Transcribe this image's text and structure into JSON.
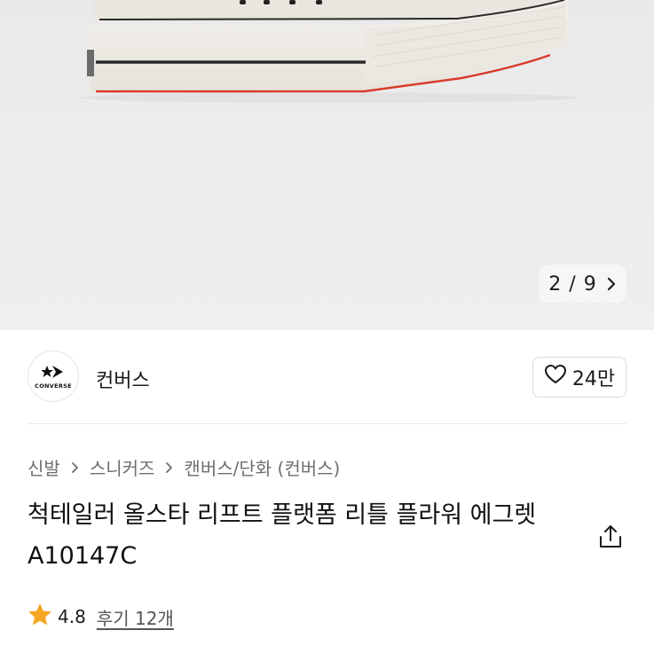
{
  "gallery": {
    "pager_text": "2 / 9"
  },
  "brand": {
    "logo_text": "CONVERSE",
    "name": "컨버스",
    "like_count": "24만"
  },
  "breadcrumb": {
    "items": [
      "신발",
      "스니커즈",
      "캔버스/단화 (컨버스)"
    ]
  },
  "product": {
    "title": "척테일러 올스타 리프트 플랫폼 리틀 플라워 에그렛 A10147C"
  },
  "rating": {
    "score": "4.8",
    "reviews": "후기 12개"
  },
  "colors": {
    "star": "#f5a623",
    "text": "#1a1a1a",
    "muted": "#6e6e6e"
  }
}
